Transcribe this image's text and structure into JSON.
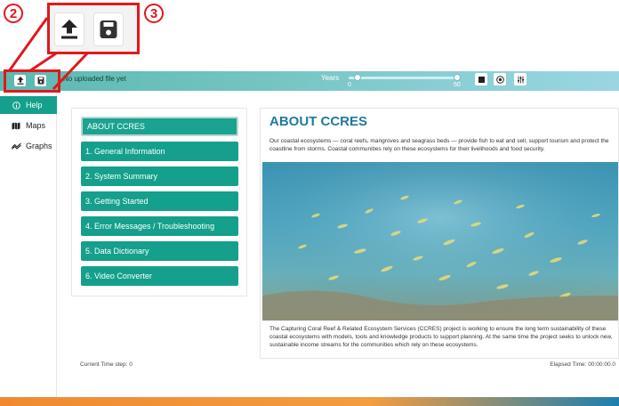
{
  "toolbar": {
    "file_status": "No uploaded file yet",
    "years_label": "Years",
    "slider_min": "0",
    "slider_max": "50",
    "slider_value": 0
  },
  "callouts": {
    "badge_left": "2",
    "badge_right": "3"
  },
  "sidebar": {
    "items": [
      {
        "label": "Help",
        "icon": "info-circle-icon"
      },
      {
        "label": "Maps",
        "icon": "map-icon"
      },
      {
        "label": "Graphs",
        "icon": "chart-line-icon"
      }
    ]
  },
  "menu": {
    "items": [
      "ABOUT CCRES",
      "1. General Information",
      "2. System Summary",
      "3. Getting Started",
      "4. Error Messages / Troubleshooting",
      "5. Data Dictionary",
      "6. Video Converter"
    ]
  },
  "article": {
    "title": "ABOUT CCRES",
    "intro": "Our coastal ecosystems — coral reefs, mangroves and seagrass beds — provide fish to eat and sell, support tourism and protect the coastline from storms. Coastal communities rely on these ecosystems for their livelihoods and food security.",
    "footer": "The Capturing Coral Reef & Related Ecosystem Services (CCRES) project is working to ensure the long term sustainability of these coastal ecosystems with models, tools and knowledge products to support planning. At the same time the project seeks to unlock new, sustainable income streams for the communities which rely on these ecosystems."
  },
  "status": {
    "current_time": "Current Time step: 0",
    "elapsed_time": "Elapsed Time: 00:00:00.0"
  },
  "colors": {
    "accent": "#14a08c",
    "title": "#1e7a9e",
    "callout": "#e0191c"
  }
}
